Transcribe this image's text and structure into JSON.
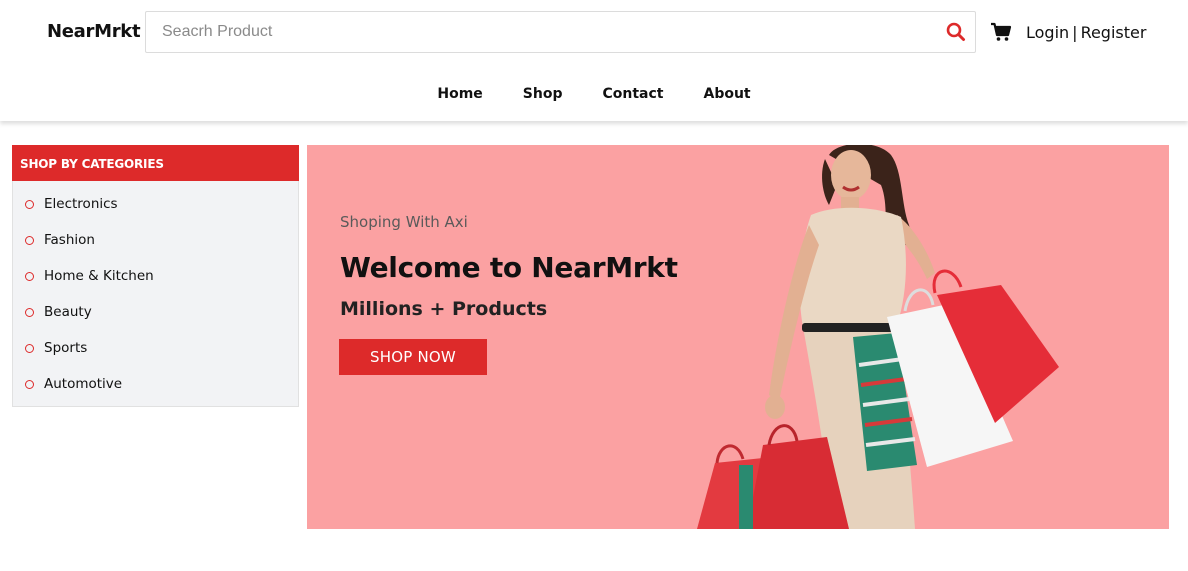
{
  "header": {
    "brand": "NearMrkt",
    "search_placeholder": "Seacrh Product",
    "search_icon": "search-icon",
    "cart_icon": "cart-icon",
    "login": "Login",
    "separator": "|",
    "register": "Register"
  },
  "nav": {
    "items": [
      "Home",
      "Shop",
      "Contact",
      "About"
    ]
  },
  "sidebar": {
    "title": "SHOP BY CATEGORIES",
    "items": [
      "Electronics",
      "Fashion",
      "Home & Kitchen",
      "Beauty",
      "Sports",
      "Automotive"
    ]
  },
  "banner": {
    "subtitle": "Shoping With Axi",
    "title": "Welcome to NearMrkt",
    "tagline": "Millions + Products",
    "button": "SHOP NOW"
  },
  "colors": {
    "accent": "#dd2a2a",
    "banner_bg": "#fba1a2",
    "sidebar_bg": "#f2f3f5"
  }
}
